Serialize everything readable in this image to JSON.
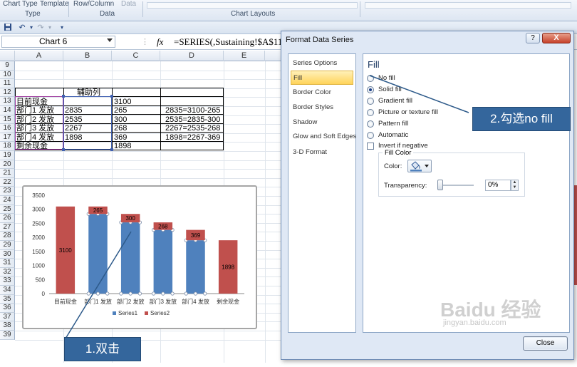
{
  "ribbon": {
    "items": [
      "Chart Type",
      "Template",
      "Row/Column",
      "Data"
    ],
    "groups": [
      "Type",
      "Data",
      "Chart Layouts"
    ]
  },
  "formula_bar": {
    "name_box": "Chart 6",
    "fx": "fx",
    "formula": "=SERIES(,Sustaining!$A$11:$"
  },
  "columns": [
    "A",
    "B",
    "C",
    "D",
    "E"
  ],
  "rows": [
    "9",
    "10",
    "11",
    "12",
    "13",
    "14",
    "15",
    "16",
    "17",
    "18",
    "19",
    "20",
    "21",
    "22",
    "23",
    "24",
    "25",
    "26",
    "27",
    "28",
    "29",
    "30",
    "31",
    "32",
    "33",
    "34",
    "35",
    "36",
    "37",
    "38",
    "39"
  ],
  "table": {
    "header_b": "辅助列",
    "r11": {
      "a": "目前现金",
      "c": "3100"
    },
    "r12": {
      "a": "部门1 发放",
      "b": "2835",
      "c": "265",
      "d": "2835=3100-265"
    },
    "r13": {
      "a": "部门2 发放",
      "b": "2535",
      "c": "300",
      "d": "2535=2835-300"
    },
    "r14": {
      "a": "部门3 发放",
      "b": "2267",
      "c": "268",
      "d": "2267=2535-268"
    },
    "r15": {
      "a": "部门4 发放",
      "b": "1898",
      "c": "369",
      "d": "1898=2267-369"
    },
    "r16": {
      "a": "剩余现金",
      "c": "1898"
    }
  },
  "chart_data": {
    "type": "bar",
    "stacked": true,
    "categories": [
      "目前现金",
      "部门1 发放",
      "部门2 发放",
      "部门3 发放",
      "部门4 发放",
      "剩余现金"
    ],
    "series": [
      {
        "name": "Series1",
        "values": [
          0,
          2835,
          2535,
          2267,
          1898,
          0
        ],
        "color": "#4f81bd"
      },
      {
        "name": "Series2",
        "values": [
          3100,
          265,
          300,
          268,
          369,
          1898
        ],
        "color": "#c0504d"
      }
    ],
    "data_labels": [
      "3100",
      "265",
      "300",
      "268",
      "369",
      "1898"
    ],
    "ylim": [
      0,
      3500
    ],
    "yticks": [
      "0",
      "500",
      "1000",
      "1500",
      "2000",
      "2500",
      "3000",
      "3500"
    ],
    "legend": "bottom",
    "grid": false
  },
  "dialog": {
    "title": "Format Data Series",
    "help": "?",
    "close_x": "X",
    "nav": [
      "Series Options",
      "Fill",
      "Border Color",
      "Border Styles",
      "Shadow",
      "Glow and Soft Edges",
      "3-D Format"
    ],
    "selected_nav": "Fill",
    "heading": "Fill",
    "options": [
      "No fill",
      "Solid fill",
      "Gradient fill",
      "Picture or texture fill",
      "Pattern fill",
      "Automatic"
    ],
    "selected_option": "Solid fill",
    "invert_label": "Invert if negative",
    "fill_color_label": "Fill Color",
    "color_label": "Color:",
    "transparency_label": "Transparency:",
    "transparency_value": "0%",
    "close_button": "Close"
  },
  "callouts": {
    "step1": "1.双击",
    "step2": "2.勾选no fill"
  },
  "watermark": {
    "brand": "Baidu 经验",
    "url": "jingyan.baidu.com"
  },
  "colors": {
    "series1": "#4f81bd",
    "series2": "#c0504d",
    "callout": "#34669c",
    "nav_selected": "#ffd45a"
  }
}
